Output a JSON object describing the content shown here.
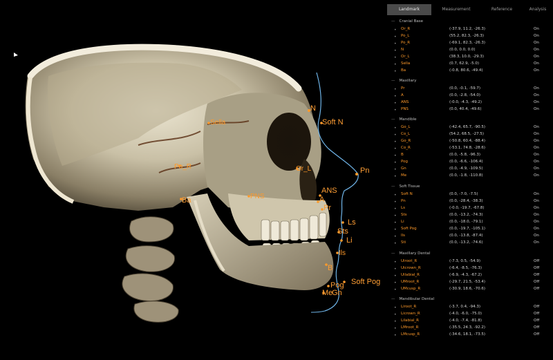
{
  "tabs": [
    {
      "label": "Landmark",
      "active": true
    },
    {
      "label": "Measurement",
      "active": false
    },
    {
      "label": "Reference",
      "active": false
    },
    {
      "label": "Analysis",
      "active": false
    }
  ],
  "groups": [
    {
      "name": "Cranial Base",
      "rows": [
        {
          "name": "Or_R",
          "coord": "(-37.9, 11.2, -26.3)",
          "state": "On"
        },
        {
          "name": "Po_L",
          "coord": "(55.2, 82.3, -26.3)",
          "state": "On"
        },
        {
          "name": "Po_R",
          "coord": "(-69.1, 82.3, -26.3)",
          "state": "On"
        },
        {
          "name": "N",
          "coord": "(0.0, 0.0, 0.0)",
          "state": "On"
        },
        {
          "name": "Or_L",
          "coord": "(38.3, 10.0, -29.3)",
          "state": "On"
        },
        {
          "name": "Sella",
          "coord": "(0.7, 62.9, -5.0)",
          "state": "On"
        },
        {
          "name": "Ba",
          "coord": "(-0.8, 80.6, -49.4)",
          "state": "On"
        }
      ]
    },
    {
      "name": "Maxillary",
      "rows": [
        {
          "name": "Pr",
          "coord": "(0.0, -0.1, -59.7)",
          "state": "On"
        },
        {
          "name": "A",
          "coord": "(0.0, -2.8, -54.0)",
          "state": "On"
        },
        {
          "name": "ANS",
          "coord": "(-0.0, -4.3, -49.2)",
          "state": "On"
        },
        {
          "name": "PNS",
          "coord": "(0.0, 40.4, -49.6)",
          "state": "On"
        }
      ]
    },
    {
      "name": "Mandible",
      "rows": [
        {
          "name": "Go_L",
          "coord": "(-42.4, 65.7, -90.5)",
          "state": "On"
        },
        {
          "name": "Co_L",
          "coord": "(54.2, 68.5, -27.5)",
          "state": "On"
        },
        {
          "name": "Go_R",
          "coord": "(-50.8, 60.4, -88.4)",
          "state": "On"
        },
        {
          "name": "Co_R",
          "coord": "(-53.1, 74.8, -28.6)",
          "state": "On"
        },
        {
          "name": "B",
          "coord": "(0.0, -5.8, -96.3)",
          "state": "On"
        },
        {
          "name": "Pog",
          "coord": "(0.0, -6.6, -106.4)",
          "state": "On"
        },
        {
          "name": "Gn",
          "coord": "(0.0, -4.9, -109.5)",
          "state": "On"
        },
        {
          "name": "Me",
          "coord": "(0.0, -1.8, -110.8)",
          "state": "On"
        }
      ]
    },
    {
      "name": "Soft Tissue",
      "rows": [
        {
          "name": "Soft N",
          "coord": "(0.0, -7.0, -7.5)",
          "state": "On"
        },
        {
          "name": "Pn",
          "coord": "(0.0, -28.4, -38.3)",
          "state": "On"
        },
        {
          "name": "Ls",
          "coord": "(-0.0, -19.7, -67.8)",
          "state": "On"
        },
        {
          "name": "Sts",
          "coord": "(0.0, -13.2, -74.3)",
          "state": "On"
        },
        {
          "name": "Li",
          "coord": "(0.0, -18.0, -79.1)",
          "state": "On"
        },
        {
          "name": "Soft Pog",
          "coord": "(0.0, -19.7, -105.1)",
          "state": "On"
        },
        {
          "name": "Ils",
          "coord": "(0.0, -13.8, -87.4)",
          "state": "On"
        },
        {
          "name": "Sti",
          "coord": "(0.0, -13.2, -74.6)",
          "state": "On"
        }
      ]
    },
    {
      "name": "Maxillary Dental",
      "rows": [
        {
          "name": "Uiroot_R",
          "coord": "(-7.3, 0.5, -54.9)",
          "state": "Off"
        },
        {
          "name": "Uicrown_R",
          "coord": "(-6.4, -8.5, -76.3)",
          "state": "Off"
        },
        {
          "name": "Uilabial_R",
          "coord": "(-6.9, -4.3, -67.2)",
          "state": "Off"
        },
        {
          "name": "UMroot_R",
          "coord": "(-29.7, 21.5, -53.4)",
          "state": "Off"
        },
        {
          "name": "UMcusp_R",
          "coord": "(-30.9, 18.6, -70.6)",
          "state": "Off"
        }
      ]
    },
    {
      "name": "Mandibular Dental",
      "rows": [
        {
          "name": "Liroot_R",
          "coord": "(-3.7, 0.4, -94.3)",
          "state": "Off"
        },
        {
          "name": "Licrown_R",
          "coord": "(-4.0, -6.0, -75.0)",
          "state": "Off"
        },
        {
          "name": "Lilabial_R",
          "coord": "(-4.0, -7.4, -81.8)",
          "state": "Off"
        },
        {
          "name": "LMroot_R",
          "coord": "(-35.5, 24.3, -92.2)",
          "state": "Off"
        },
        {
          "name": "LMcusp_R",
          "coord": "(-34.6, 18.1, -73.5)",
          "state": "Off"
        }
      ]
    }
  ],
  "viewport_labels": [
    {
      "text": "N",
      "big": true
    },
    {
      "text": "Soft N",
      "big": true
    },
    {
      "text": "Pn",
      "big": true
    },
    {
      "text": "ANS",
      "big": true
    },
    {
      "text": "A",
      "big": true
    },
    {
      "text": "Pr",
      "big": true
    },
    {
      "text": "Ls",
      "big": true
    },
    {
      "text": "Sts",
      "big": true
    },
    {
      "text": "Li",
      "big": true
    },
    {
      "text": "Ils",
      "big": false
    },
    {
      "text": "B",
      "big": true
    },
    {
      "text": "Pog",
      "big": true
    },
    {
      "text": "Soft Pog",
      "big": true
    },
    {
      "text": "Me",
      "big": true
    },
    {
      "text": "Gn",
      "big": true
    },
    {
      "text": "Ba",
      "big": true
    },
    {
      "text": "Sella",
      "big": false
    },
    {
      "text": "Po_R",
      "big": false
    },
    {
      "text": "PNS",
      "big": false
    },
    {
      "text": "Or_L",
      "big": false
    }
  ],
  "colors": {
    "accent": "#ff9a2a",
    "profile_line": "#6fb4e8",
    "active_tab": "#4a4a4a",
    "background": "#000000"
  }
}
